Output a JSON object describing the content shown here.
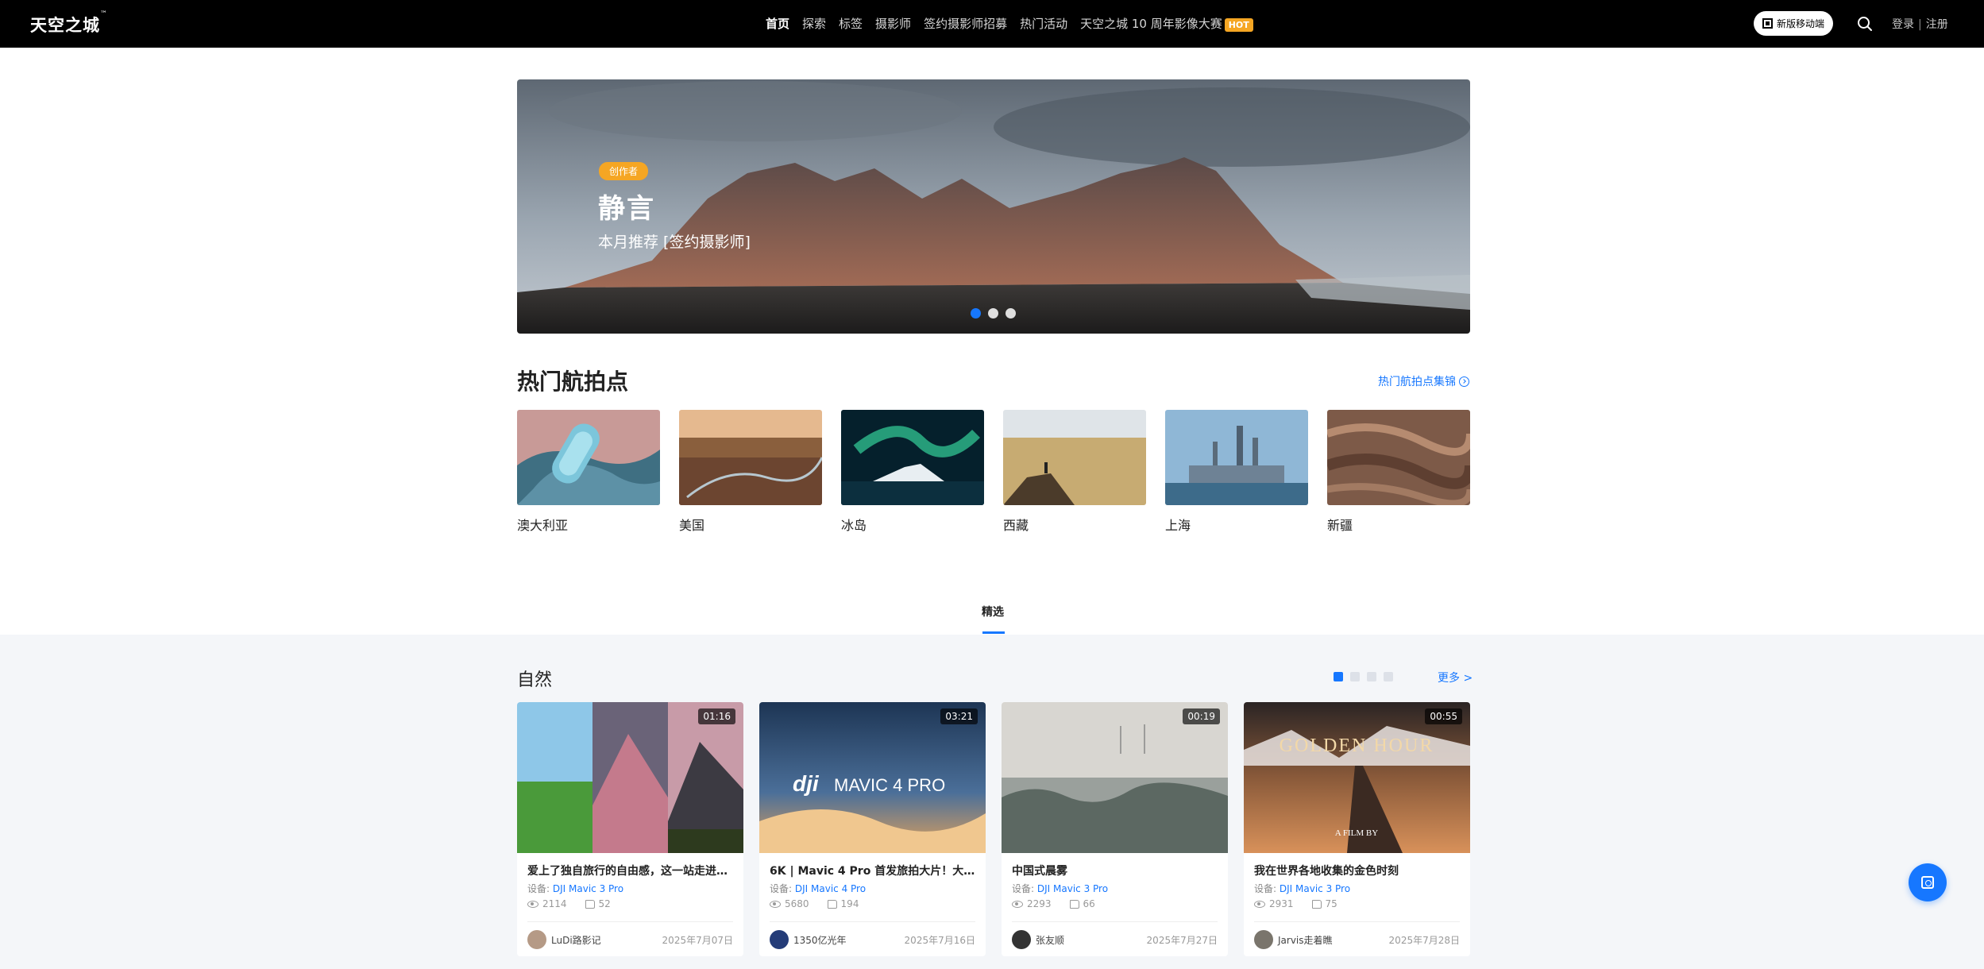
{
  "header": {
    "logo": "天空之城",
    "logo_tm": "™",
    "nav": [
      "首页",
      "探索",
      "标签",
      "摄影师",
      "签约摄影师招募",
      "热门活动",
      "天空之城 10 周年影像大赛"
    ],
    "hot_badge": "HOT",
    "mobile_button": "新版移动端",
    "login": "登录",
    "separator": "|",
    "register": "注册"
  },
  "banner": {
    "badge": "创作者",
    "name": "静言",
    "subtitle": "本月推荐 [签约摄影师]"
  },
  "hotspots": {
    "title": "热门航拍点",
    "link": "热门航拍点集锦",
    "items": [
      "澳大利亚",
      "美国",
      "冰岛",
      "西藏",
      "上海",
      "新疆"
    ]
  },
  "tabs": {
    "selected": "精选"
  },
  "nature": {
    "title": "自然",
    "more": "更多 >",
    "device_prefix": "设备:",
    "cards": [
      {
        "duration": "01:16",
        "title": "爱上了独自旅行的自由感，这一站走进…",
        "device": "DJI Mavic 3 Pro",
        "views": "2114",
        "likes": "52",
        "author": "LuDi路影记",
        "date": "2025年7月07日"
      },
      {
        "duration": "03:21",
        "title": "6K | Mavic 4 Pro 首发旅拍大片！大疆…",
        "device": "DJI Mavic 4 Pro",
        "views": "5680",
        "likes": "194",
        "author": "1350亿光年",
        "date": "2025年7月16日",
        "image_text": "MAVIC 4 PRO"
      },
      {
        "duration": "00:19",
        "title": "中国式晨雾",
        "device": "DJI Mavic 3 Pro",
        "views": "2293",
        "likes": "66",
        "author": "张友顺",
        "date": "2025年7月27日"
      },
      {
        "duration": "00:55",
        "title": "我在世界各地收集的金色时刻",
        "device": "DJI Mavic 3 Pro",
        "views": "2931",
        "likes": "75",
        "author": "Jarvis走着瞧",
        "date": "2025年7月28日",
        "image_text": "GOLDEN HOUR",
        "image_text2": "A FILM BY"
      }
    ]
  },
  "colors": {
    "accent": "#1677ff",
    "hot": "#f5a623",
    "header_bg": "#000000"
  }
}
